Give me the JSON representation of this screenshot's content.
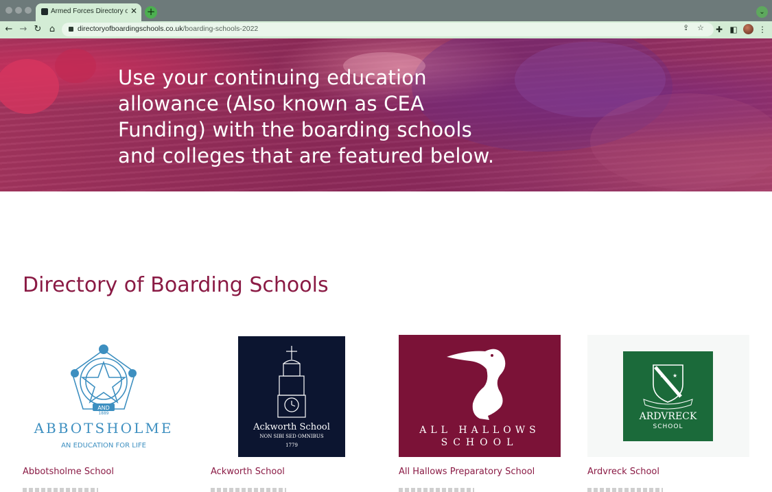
{
  "browser": {
    "tab_title": "Armed Forces Directory of Boa",
    "tab_close": "✕",
    "new_tab": "+",
    "tab_search": "⌄",
    "url_host": "directoryofboardingschools.co.uk",
    "url_path": "/boarding-schools-2022",
    "icons": [
      "back-icon",
      "forward-icon",
      "reload-icon",
      "home-icon",
      "share-icon",
      "bookmark-star-icon",
      "extensions-icon",
      "side-panel-icon",
      "profile-avatar",
      "menu-icon"
    ]
  },
  "hero": {
    "text": "Use your continuing education allowance (Also known as CEA Funding) with the boarding schools and colleges that are featured below."
  },
  "directory": {
    "title": "Directory of Boarding Schools",
    "schools": [
      {
        "name": "Abbotsholme School",
        "logo_wordmark": "ABBOTSHOLME",
        "logo_tagline": "AN EDUCATION FOR LIFE",
        "logo_crest": "AND",
        "logo_year": "1889",
        "logo_color": "#3d8fc0"
      },
      {
        "name": "Ackworth School",
        "logo_wordmark": "Ackworth School",
        "logo_motto": "NON SIBI SED OMNIBUS",
        "logo_year": "1779",
        "logo_bg": "#0c1530"
      },
      {
        "name": "All Hallows Preparatory School",
        "logo_line1": "ALL HALLOWS",
        "logo_line2": "SCHOOL",
        "logo_bg": "#7b1237"
      },
      {
        "name": "Ardvreck School",
        "logo_wordmark": "ARDVRECK",
        "logo_sub": "SCHOOL",
        "logo_bg": "#1b6a3a"
      }
    ]
  },
  "colors": {
    "accent": "#8a1a44",
    "browser_frame": "#d3ecd5"
  }
}
